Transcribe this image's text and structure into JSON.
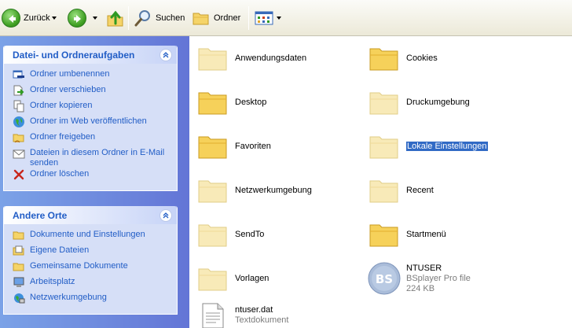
{
  "toolbar": {
    "back_label": "Zurück",
    "search_label": "Suchen",
    "folders_label": "Ordner"
  },
  "panels": {
    "tasks": {
      "title": "Datei- und Ordneraufgaben",
      "items": [
        {
          "label": "Ordner umbenennen",
          "icon": "rename-icon"
        },
        {
          "label": "Ordner verschieben",
          "icon": "move-icon"
        },
        {
          "label": "Ordner kopieren",
          "icon": "copy-icon"
        },
        {
          "label": "Ordner im Web veröffentlichen",
          "icon": "globe-icon"
        },
        {
          "label": "Ordner freigeben",
          "icon": "share-icon"
        },
        {
          "label": "Dateien in diesem Ordner in E-Mail senden",
          "icon": "email-icon"
        },
        {
          "label": "Ordner löschen",
          "icon": "delete-icon"
        }
      ]
    },
    "places": {
      "title": "Andere Orte",
      "items": [
        {
          "label": "Dokumente und Einstellungen",
          "icon": "folder-icon"
        },
        {
          "label": "Eigene Dateien",
          "icon": "my-documents-icon"
        },
        {
          "label": "Gemeinsame Dokumente",
          "icon": "folder-icon"
        },
        {
          "label": "Arbeitsplatz",
          "icon": "computer-icon"
        },
        {
          "label": "Netzwerkumgebung",
          "icon": "network-icon"
        }
      ]
    }
  },
  "files": {
    "col1": [
      {
        "name": "Anwendungsdaten",
        "style": "faded"
      },
      {
        "name": "Desktop",
        "style": "normal"
      },
      {
        "name": "Favoriten",
        "style": "normal"
      },
      {
        "name": "Netzwerkumgebung",
        "style": "faded"
      },
      {
        "name": "SendTo",
        "style": "faded"
      },
      {
        "name": "Vorlagen",
        "style": "faded"
      }
    ],
    "col2": [
      {
        "name": "Cookies",
        "style": "normal"
      },
      {
        "name": "Druckumgebung",
        "style": "faded"
      },
      {
        "name": "Lokale Einstellungen",
        "style": "faded",
        "selected": true
      },
      {
        "name": "Recent",
        "style": "faded"
      },
      {
        "name": "Startmenü",
        "style": "normal"
      }
    ],
    "ntuser": {
      "name": "NTUSER",
      "type": "BSplayer Pro file",
      "size": "224 KB",
      "icon_text": "BS"
    },
    "ntuser_dat": {
      "name": "ntuser.dat",
      "type": "Textdokument"
    }
  },
  "colors": {
    "link_blue": "#215dc6",
    "selection": "#316ac5",
    "pane_blue": "#6f8fe0"
  }
}
